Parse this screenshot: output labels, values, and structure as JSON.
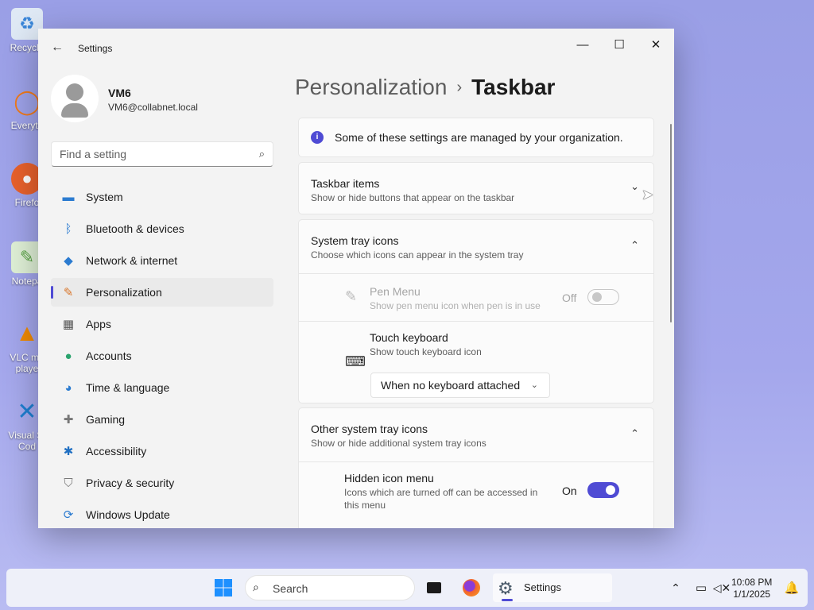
{
  "desktop": {
    "icons": [
      {
        "label": "Recycle",
        "icon": "recycle-bin-icon",
        "color": "#3a86d9"
      },
      {
        "label": "Everyth",
        "icon": "everything-search-icon",
        "color": "#f07a1a"
      },
      {
        "label": "Firefo",
        "icon": "firefox-icon",
        "color": "#e8612c"
      },
      {
        "label": "Notepa",
        "icon": "notepad-icon",
        "color": "#5da54a"
      },
      {
        "label": "VLC me",
        "label2": "playe",
        "icon": "vlc-icon",
        "color": "#f08a00"
      },
      {
        "label": "Visual St",
        "label2": "Cod",
        "icon": "vscode-icon",
        "color": "#1f7fd1"
      }
    ]
  },
  "window": {
    "title": "Settings",
    "back_icon": "back-arrow-icon",
    "controls": {
      "minimize": "—",
      "maximize": "☐",
      "close": "✕"
    }
  },
  "sidebar": {
    "profile": {
      "name": "VM6",
      "email": "VM6@collabnet.local"
    },
    "search": {
      "placeholder": "Find a setting",
      "icon": "search-icon"
    },
    "items": [
      {
        "label": "System",
        "icon": "system-display-icon",
        "glyph": "▬",
        "color": "#2b7bd0"
      },
      {
        "label": "Bluetooth & devices",
        "icon": "bluetooth-icon",
        "glyph": "ᛒ",
        "color": "#2b7bd0"
      },
      {
        "label": "Network & internet",
        "icon": "wifi-icon",
        "glyph": "◆",
        "color": "#2b7bd0"
      },
      {
        "label": "Personalization",
        "icon": "paintbrush-icon",
        "glyph": "✎",
        "color": "#d9762b",
        "active": true
      },
      {
        "label": "Apps",
        "icon": "apps-icon",
        "glyph": "▦",
        "color": "#555"
      },
      {
        "label": "Accounts",
        "icon": "accounts-icon",
        "glyph": "●",
        "color": "#2aa36d"
      },
      {
        "label": "Time & language",
        "icon": "globe-clock-icon",
        "glyph": "◕",
        "color": "#2b7bd0"
      },
      {
        "label": "Gaming",
        "icon": "gamepad-icon",
        "glyph": "✚",
        "color": "#777"
      },
      {
        "label": "Accessibility",
        "icon": "accessibility-icon",
        "glyph": "✱",
        "color": "#1f6fc2"
      },
      {
        "label": "Privacy & security",
        "icon": "shield-icon",
        "glyph": "⛉",
        "color": "#777"
      },
      {
        "label": "Windows Update",
        "icon": "windows-update-icon",
        "glyph": "⟳",
        "color": "#2b7bd0"
      }
    ]
  },
  "main": {
    "breadcrumb": {
      "parent": "Personalization",
      "separator": "›",
      "current": "Taskbar"
    },
    "notice": {
      "icon": "info-icon",
      "text": "Some of these settings are managed by your organization."
    },
    "taskbar_items": {
      "title": "Taskbar items",
      "subtitle": "Show or hide buttons that appear on the taskbar",
      "chevron": "⌄"
    },
    "system_tray": {
      "title": "System tray icons",
      "subtitle": "Choose which icons can appear in the system tray",
      "chevron": "⌃",
      "pen_menu": {
        "title": "Pen Menu",
        "subtitle": "Show pen menu icon when pen is in use",
        "state": "Off",
        "icon": "pen-icon"
      },
      "touch_keyboard": {
        "title": "Touch keyboard",
        "subtitle": "Show touch keyboard icon",
        "dropdown_value": "When no keyboard attached",
        "icon": "keyboard-icon"
      }
    },
    "other_tray": {
      "title": "Other system tray icons",
      "subtitle": "Show or hide additional system tray icons",
      "chevron": "⌃",
      "hidden_icon_menu": {
        "title": "Hidden icon menu",
        "subtitle_line1": "Icons which are turned off can be accessed in",
        "subtitle_line2": "this menu",
        "state": "On"
      }
    }
  },
  "taskbar": {
    "search_label": "Search",
    "settings_label": "Settings",
    "clock": {
      "time": "10:08 PM",
      "date": "1/1/2025"
    },
    "accent": "#4f4bd4"
  }
}
